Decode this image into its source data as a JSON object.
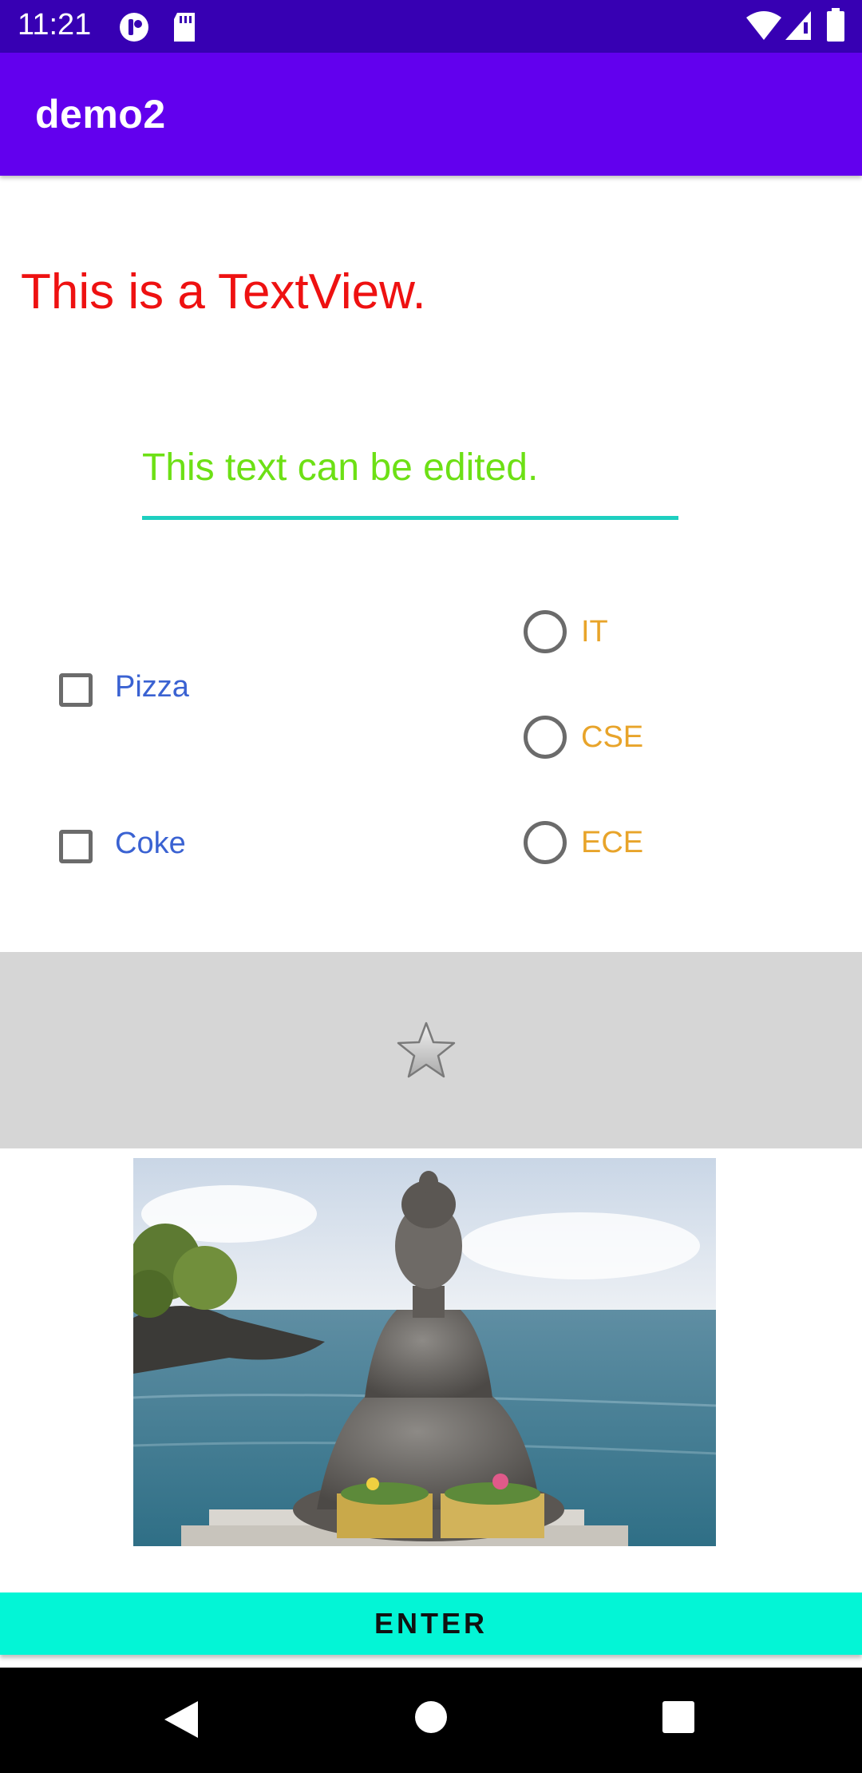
{
  "status_bar": {
    "time": "11:21",
    "icons": [
      "notification-icon",
      "sd-card-icon",
      "wifi-icon",
      "signal-icon",
      "battery-icon"
    ]
  },
  "app_bar": {
    "title": "demo2"
  },
  "text_view": {
    "text": "This is a TextView.",
    "color": "#ee1111"
  },
  "edit_text": {
    "value": "This text can be edited.",
    "color": "#6de015",
    "underline_color": "#1ecfc0"
  },
  "checkboxes": [
    {
      "label": "Pizza",
      "checked": false
    },
    {
      "label": "Coke",
      "checked": false
    }
  ],
  "radios": [
    {
      "label": "IT",
      "selected": false
    },
    {
      "label": "CSE",
      "selected": false
    },
    {
      "label": "ECE",
      "selected": false
    }
  ],
  "image_button": {
    "icon": "star-icon"
  },
  "photo": {
    "subject": "buddha-statue-photo"
  },
  "enter_button": {
    "label": "ENTER",
    "color": "#03f5d6"
  },
  "nav_bar": {
    "icons": [
      "back-icon",
      "home-icon",
      "recents-icon"
    ]
  },
  "colors": {
    "status_bar": "#3700b3",
    "app_bar": "#6200ee",
    "checkbox_label": "#3a62d2",
    "radio_label": "#e8a42a"
  }
}
